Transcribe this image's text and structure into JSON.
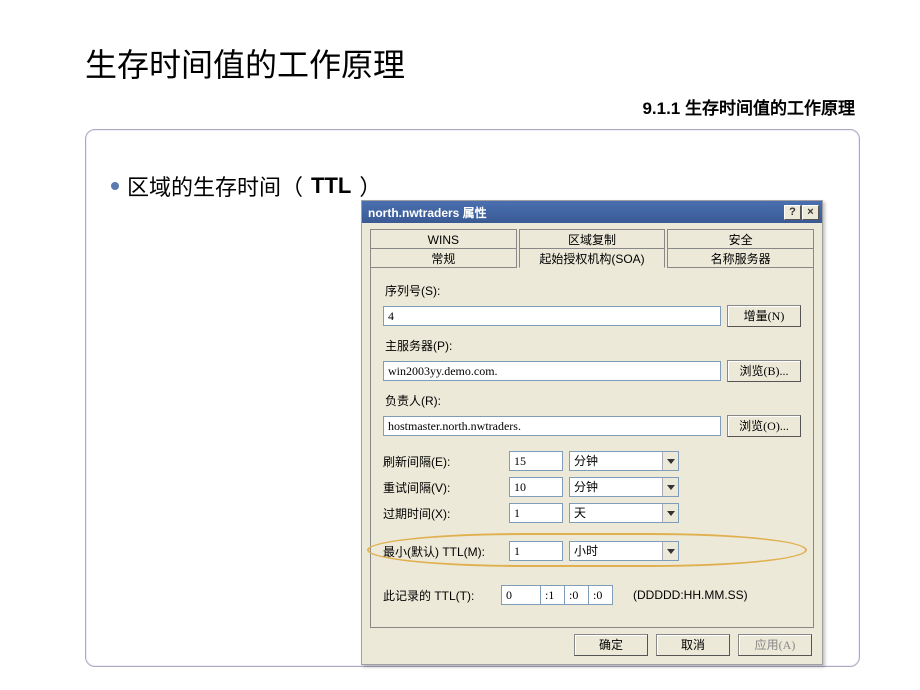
{
  "slide": {
    "title": "生存时间值的工作原理",
    "subtitle": "9.1.1  生存时间值的工作原理",
    "bullet": "区域的生存时间（",
    "bullet_strong": "TTL",
    "bullet_tail": "）"
  },
  "dialog": {
    "title": "north.nwtraders 属性",
    "tabs_back": [
      "WINS",
      "区域复制",
      "安全"
    ],
    "tabs_front": [
      "常规",
      "起始授权机构(SOA)",
      "名称服务器"
    ],
    "selected_tab": "起始授权机构(SOA)",
    "serial": {
      "label": "序列号(S):",
      "value": "4",
      "inc_btn": "增量(N)"
    },
    "primary": {
      "label": "主服务器(P):",
      "value": "win2003yy.demo.com.",
      "browse_btn": "浏览(B)..."
    },
    "responsible": {
      "label": "负责人(R):",
      "value": "hostmaster.north.nwtraders.",
      "browse_btn": "浏览(O)..."
    },
    "refresh": {
      "label": "刷新间隔(E):",
      "value": "15",
      "unit": "分钟"
    },
    "retry": {
      "label": "重试间隔(V):",
      "value": "10",
      "unit": "分钟"
    },
    "expire": {
      "label": "过期时间(X):",
      "value": "1",
      "unit": "天"
    },
    "minttl": {
      "label": "最小(默认) TTL(M):",
      "value": "1",
      "unit": "小时"
    },
    "recttl": {
      "label": "此记录的 TTL(T):",
      "d": "0",
      "h": ":1",
      "m": ":0",
      "s": ":0",
      "hint": "(DDDDD:HH.MM.SS)"
    },
    "buttons": {
      "ok": "确定",
      "cancel": "取消",
      "apply": "应用(A)"
    }
  }
}
